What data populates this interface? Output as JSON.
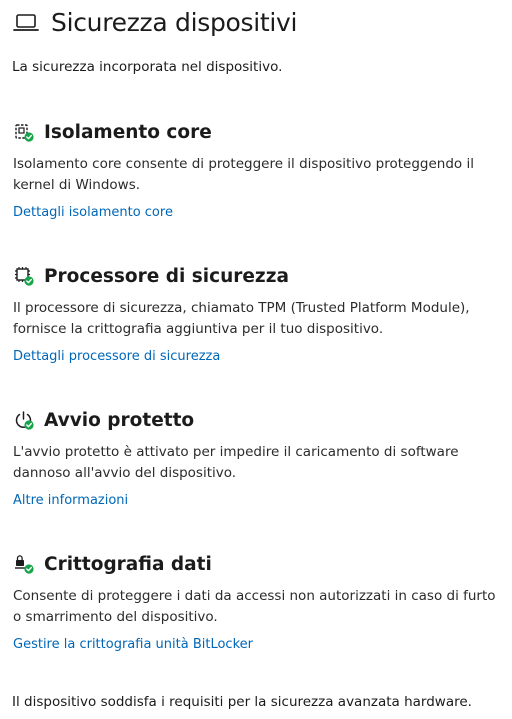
{
  "header": {
    "icon": "laptop-icon",
    "title": "Sicurezza dispositivi",
    "subtitle": "La sicurezza incorporata nel dispositivo."
  },
  "sections": [
    {
      "icon": "core-isolation-icon",
      "title": "Isolamento core",
      "description": "Isolamento core consente di proteggere il dispositivo proteggendo il kernel di Windows.",
      "link": "Dettagli isolamento core"
    },
    {
      "icon": "security-processor-icon",
      "title": "Processore di sicurezza",
      "description": "Il processore di sicurezza, chiamato TPM (Trusted Platform Module), fornisce la crittografia aggiuntiva per il tuo dispositivo.",
      "link": "Dettagli processore di sicurezza"
    },
    {
      "icon": "secure-boot-icon",
      "title": "Avvio protetto",
      "description": "L'avvio protetto è attivato per impedire il caricamento di software dannoso all'avvio del dispositivo.",
      "link": "Altre informazioni"
    },
    {
      "icon": "data-encryption-icon",
      "title": "Crittografia dati",
      "description": "Consente di proteggere i dati da accessi non autorizzati in caso di furto o smarrimento del dispositivo.",
      "link": "Gestire la crittografia unità BitLocker"
    }
  ],
  "footer": {
    "note": "Il dispositivo soddisfa i requisiti per la sicurezza avanzata hardware."
  },
  "colors": {
    "text": "#1b1b1b",
    "link": "#0067b8",
    "check": "#16a34a",
    "background": "#ffffff"
  }
}
